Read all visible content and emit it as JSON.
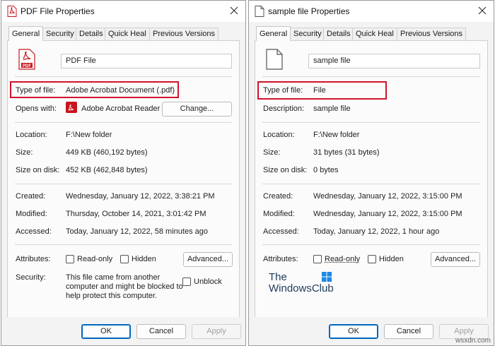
{
  "left": {
    "title": "PDF File Properties",
    "tabs": [
      "General",
      "Security",
      "Details",
      "Quick Heal",
      "Previous Versions"
    ],
    "file_name": "PDF File",
    "rows": {
      "type_label": "Type of file:",
      "type_value": "Adobe Acrobat Document (.pdf)",
      "opens_label": "Opens with:",
      "opens_value": "Adobe Acrobat Reader",
      "change_label": "Change...",
      "location_label": "Location:",
      "location_value": "F:\\New folder",
      "size_label": "Size:",
      "size_value": "449 KB (460,192 bytes)",
      "disk_label": "Size on disk:",
      "disk_value": "452 KB (462,848 bytes)",
      "created_label": "Created:",
      "created_value": "Wednesday, January 12, 2022, 3:38:21 PM",
      "modified_label": "Modified:",
      "modified_value": "Thursday, October 14, 2021, 3:01:42 PM",
      "accessed_label": "Accessed:",
      "accessed_value": "Today, January 12, 2022, 58 minutes ago",
      "attributes_label": "Attributes:",
      "readonly_label": "Read-only",
      "hidden_label": "Hidden",
      "advanced_label": "Advanced...",
      "security_label": "Security:",
      "security_line1": "This file came from another",
      "security_line2": "computer and might be blocked to",
      "security_line3": "help protect this computer.",
      "unblock_label": "Unblock"
    },
    "buttons": {
      "ok": "OK",
      "cancel": "Cancel",
      "apply": "Apply"
    }
  },
  "right": {
    "title": "sample file Properties",
    "tabs": [
      "General",
      "Security",
      "Details",
      "Quick Heal",
      "Previous Versions"
    ],
    "file_name": "sample file",
    "rows": {
      "type_label": "Type of file:",
      "type_value": "File",
      "desc_label": "Description:",
      "desc_value": "sample file",
      "location_label": "Location:",
      "location_value": "F:\\New folder",
      "size_label": "Size:",
      "size_value": "31 bytes (31 bytes)",
      "disk_label": "Size on disk:",
      "disk_value": "0 bytes",
      "created_label": "Created:",
      "created_value": "Wednesday, January 12, 2022, 3:15:00 PM",
      "modified_label": "Modified:",
      "modified_value": "Wednesday, January 12, 2022, 3:15:00 PM",
      "accessed_label": "Accessed:",
      "accessed_value": "Today, January 12, 2022, 1 hour ago",
      "attributes_label": "Attributes:",
      "readonly_label": "Read-only",
      "hidden_label": "Hidden",
      "advanced_label": "Advanced..."
    },
    "watermark_line1": "The",
    "watermark_line2": "WindowsClub",
    "buttons": {
      "ok": "OK",
      "cancel": "Cancel",
      "apply": "Apply"
    }
  },
  "site_watermark": "wsxdn.com",
  "colors": {
    "highlight_box": "#d0142b",
    "pdf_red": "#c8161d",
    "focus_blue": "#0067c0"
  },
  "icons": [
    "pdf-file-icon",
    "blank-file-icon",
    "close-icon",
    "acrobat-reader-icon",
    "windows-logo-icon"
  ]
}
